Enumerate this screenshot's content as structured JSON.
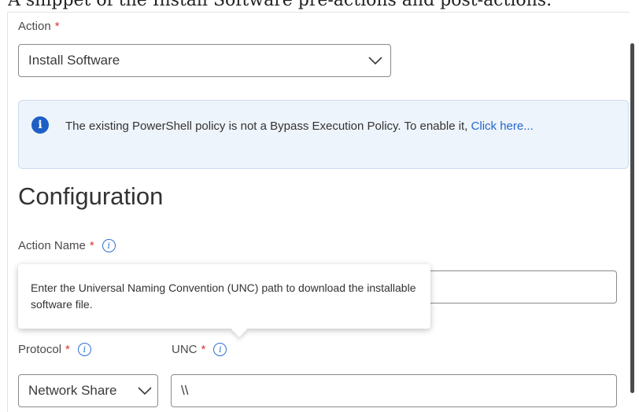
{
  "caption": "A snippet of the Install Software pre-actions and post-actions.",
  "form": {
    "action_label": "Action",
    "required_mark": "*",
    "action_value": "Install Software",
    "banner": {
      "text": "The existing PowerShell policy is not a Bypass Execution Policy. To enable it, ",
      "link": "Click here..."
    },
    "section_title": "Configuration",
    "action_name_label": "Action Name",
    "action_name_value": "",
    "tooltip": "Enter the Universal Naming Convention (UNC) path to download the installable software file.",
    "protocol_label": "Protocol",
    "protocol_value": "Network Share",
    "unc_label": "UNC",
    "unc_value": "\\\\"
  },
  "icons": {
    "info": "info-circle-icon",
    "chevron": "chevron-down-icon"
  },
  "colors": {
    "accent": "#2466cf",
    "required": "#dd3333",
    "banner_bg": "#eef4fb"
  }
}
